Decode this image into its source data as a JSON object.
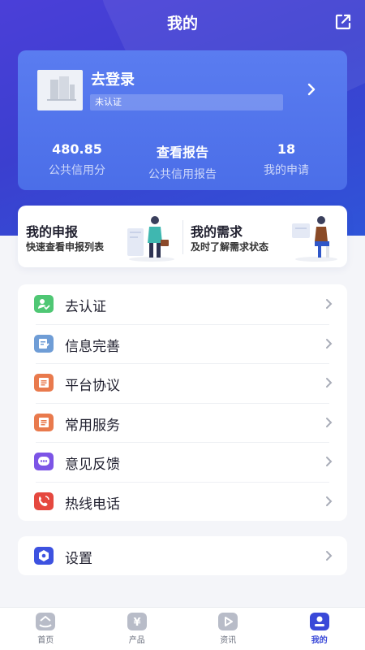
{
  "header": {
    "title": "我的"
  },
  "profile": {
    "login_label": "去登录",
    "status_badge": "未认证",
    "stats": [
      {
        "value": "480.85",
        "label": "公共信用分"
      },
      {
        "value": "查看报告",
        "label": "公共信用报告"
      },
      {
        "value": "18",
        "label": "我的申请"
      }
    ]
  },
  "quick": [
    {
      "title": "我的申报",
      "subtitle": "快速查看申报列表"
    },
    {
      "title": "我的需求",
      "subtitle": "及时了解需求状态"
    }
  ],
  "menu": [
    {
      "label": "去认证",
      "icon": "verify-icon",
      "color": "#4fc774"
    },
    {
      "label": "信息完善",
      "icon": "edit-info-icon",
      "color": "#6f9dd6"
    },
    {
      "label": "平台协议",
      "icon": "agreement-icon",
      "color": "#e97a4d"
    },
    {
      "label": "常用服务",
      "icon": "services-icon",
      "color": "#e97a4d"
    },
    {
      "label": "意见反馈",
      "icon": "feedback-icon",
      "color": "#7c54e6"
    },
    {
      "label": "热线电话",
      "icon": "hotline-icon",
      "color": "#e5483f"
    }
  ],
  "settings": {
    "label": "设置",
    "icon": "settings-icon",
    "color": "#3d52e0"
  },
  "tabs": [
    {
      "label": "首页",
      "icon": "home-icon",
      "active": false
    },
    {
      "label": "产品",
      "icon": "product-icon",
      "active": false
    },
    {
      "label": "资讯",
      "icon": "news-icon",
      "active": false
    },
    {
      "label": "我的",
      "icon": "profile-icon",
      "active": true
    }
  ],
  "colors": {
    "primary": "#3a49d8",
    "card": "#5576ec",
    "background": "#f4f5f9"
  }
}
